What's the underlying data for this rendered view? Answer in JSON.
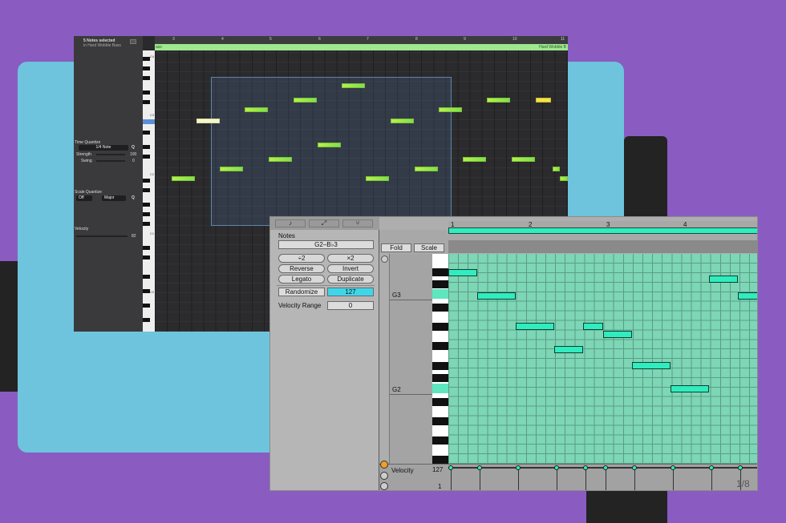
{
  "logic": {
    "header_title": "5 Notes selected",
    "header_sub": "in Hard Wobble Bass",
    "ruler_numbers": [
      "3",
      "4",
      "5",
      "6",
      "7",
      "8",
      "9",
      "10",
      "11"
    ],
    "region_left": "ass",
    "region_right": "Hard Wobble B",
    "time_quantize_label": "Time Quantize",
    "time_quantize_value": "1/4 Note",
    "strength_label": "Strength",
    "strength_value": "100",
    "swing_label": "Swing",
    "swing_value": "0",
    "scale_quantize_label": "Scale Quantize",
    "scale_off": "Off",
    "scale_major": "Major",
    "q_label": "Q",
    "velocity_label": "Velocity",
    "velocity_value": "82",
    "octave_labels": [
      "C4",
      "C3",
      "C2",
      "C1",
      "C0"
    ]
  },
  "ableton": {
    "tab_icons": [
      "note-icon",
      "expand-icon",
      "branch-icon"
    ],
    "notes_label": "Notes",
    "notes_range": "G2–B♭3",
    "btn_plus2": "÷2",
    "btn_times2": "×2",
    "btn_reverse": "Reverse",
    "btn_invert": "Invert",
    "btn_legato": "Legato",
    "btn_duplicate": "Duplicate",
    "btn_randomize": "Randomize",
    "randomize_value": "127",
    "velocity_range_label": "Velocity Range",
    "velocity_range_value": "0",
    "fold_label": "Fold",
    "scale_label": "Scale",
    "key_g3": "G3",
    "key_g2": "G2",
    "ruler_numbers": [
      "1",
      "2",
      "3",
      "4"
    ],
    "velocity_lane_label": "Velocity",
    "velocity_max": "127",
    "velocity_min": "1",
    "grid_division": "1/8",
    "accent_color": "#30ecbe"
  }
}
